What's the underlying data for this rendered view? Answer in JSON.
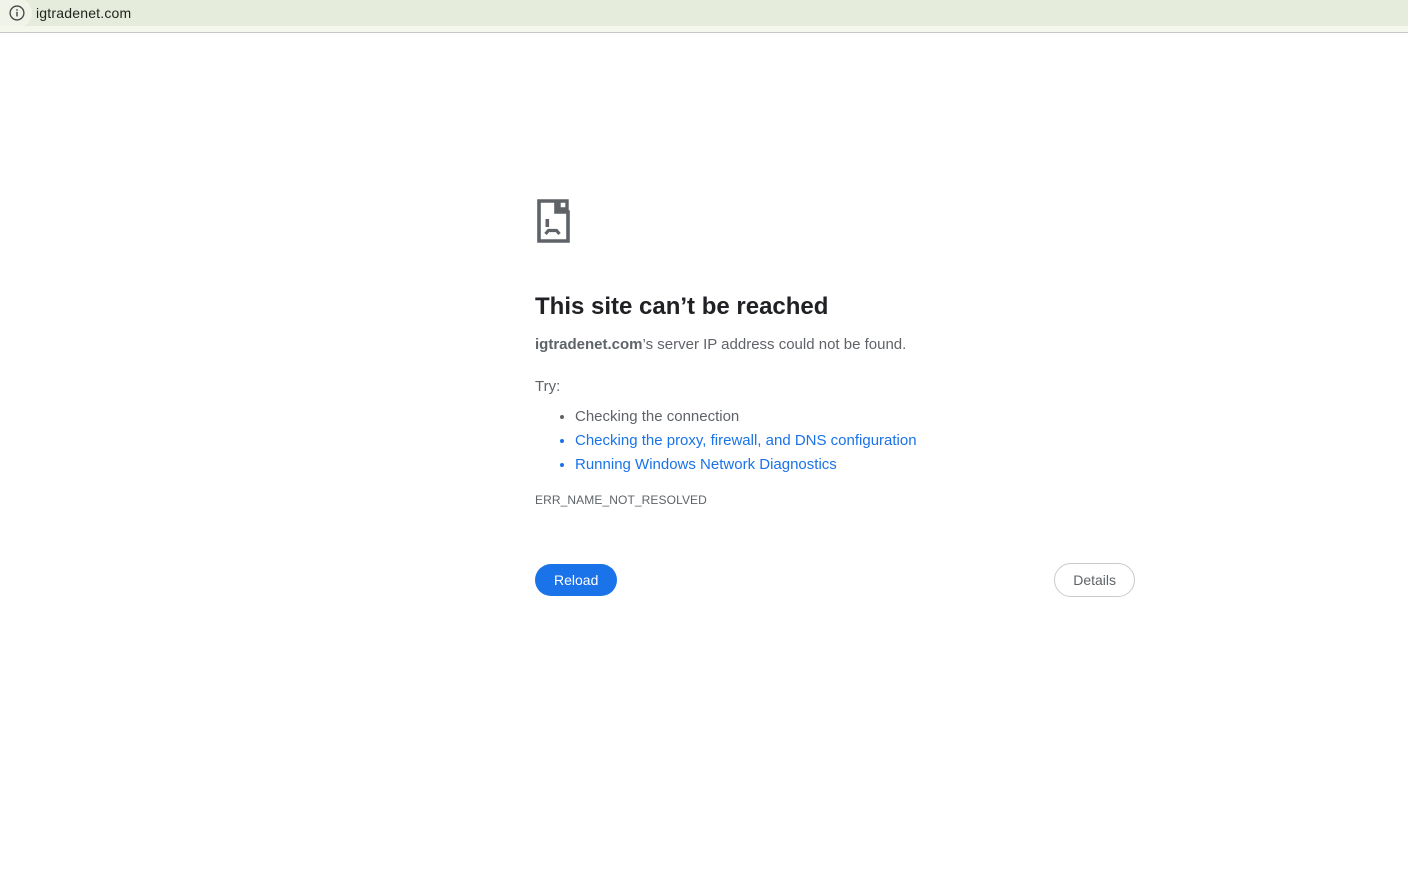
{
  "browser": {
    "omnibox": {
      "url": "igtradenet.com",
      "icon": "info-icon"
    }
  },
  "error_page": {
    "icon": "sad-page-icon",
    "title": "This site can’t be reached",
    "description": {
      "domain": "igtradenet.com",
      "rest": "’s server IP address could not be found."
    },
    "try_label": "Try:",
    "suggestions": [
      {
        "label": "Checking the connection",
        "is_link": false
      },
      {
        "label": "Checking the proxy, firewall, and DNS configuration",
        "is_link": true
      },
      {
        "label": "Running Windows Network Diagnostics",
        "is_link": true
      }
    ],
    "error_code": "ERR_NAME_NOT_RESOLVED",
    "actions": {
      "reload": "Reload",
      "details": "Details"
    }
  },
  "colors": {
    "accent_blue": "#1a73e8",
    "bar_green": "#e5ecdb",
    "strip_green": "#f4f7ec",
    "text_primary": "#202124",
    "text_secondary": "#5f6368",
    "icon_gray": "#5f6368"
  }
}
